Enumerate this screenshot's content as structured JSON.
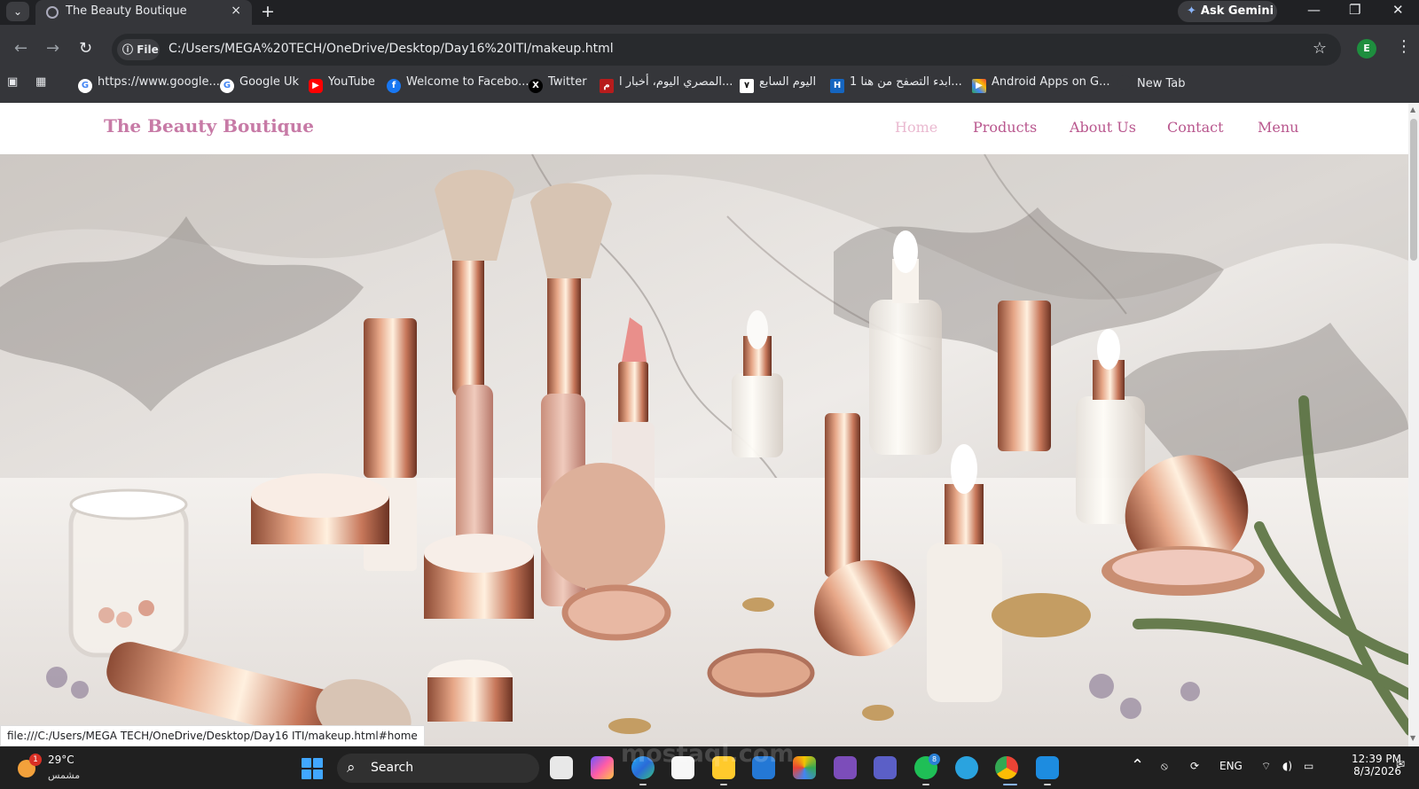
{
  "browser": {
    "tab_title": "The Beauty Boutique",
    "gemini": "Ask Gemini",
    "file_label": "File",
    "url": "C:/Users/MEGA%20TECH/OneDrive/Desktop/Day16%20ITI/makeup.html",
    "profile_initial": "E",
    "bookmarks": [
      {
        "label": "https://www.google...",
        "icon": "google-icon"
      },
      {
        "label": "Google Uk",
        "icon": "google-icon"
      },
      {
        "label": "YouTube",
        "icon": "youtube-icon"
      },
      {
        "label": "Welcome to Facebo...",
        "icon": "facebook-icon"
      },
      {
        "label": "Twitter",
        "icon": "x-icon"
      },
      {
        "label": "المصري اليوم، أخبار ا...",
        "icon": "news-icon"
      },
      {
        "label": "اليوم السابع",
        "icon": "news-icon"
      },
      {
        "label": "ابدء التصفح من هنا 1...",
        "icon": "browser-icon"
      },
      {
        "label": "Android Apps on G...",
        "icon": "play-store-icon"
      },
      {
        "label": "New Tab",
        "icon": "tab-icon"
      }
    ]
  },
  "website": {
    "brand": "The Beauty Boutique",
    "nav": [
      {
        "label": "Home",
        "active": true
      },
      {
        "label": "Products",
        "active": false
      },
      {
        "label": "About Us",
        "active": false
      },
      {
        "label": "Contact",
        "active": false
      },
      {
        "label": "Menu",
        "active": false
      }
    ],
    "hero_image": "makeup-products-hero-image"
  },
  "status_url": "file:///C:/Users/MEGA TECH/OneDrive/Desktop/Day16 ITI/makeup.html#home",
  "taskbar": {
    "weather_alert": "1",
    "temperature": "29°C",
    "condition": "مشمس",
    "search_placeholder": "Search",
    "whatsapp_badge": "8",
    "language": "ENG",
    "time": "12:39 PM",
    "date": "8/3/2026"
  },
  "watermark": "mostaql.com",
  "colors": {
    "accent": "#b9578e",
    "brand": "#c77aa6",
    "active_nav": "#eab9d0",
    "browser_dark": "#35363a"
  }
}
